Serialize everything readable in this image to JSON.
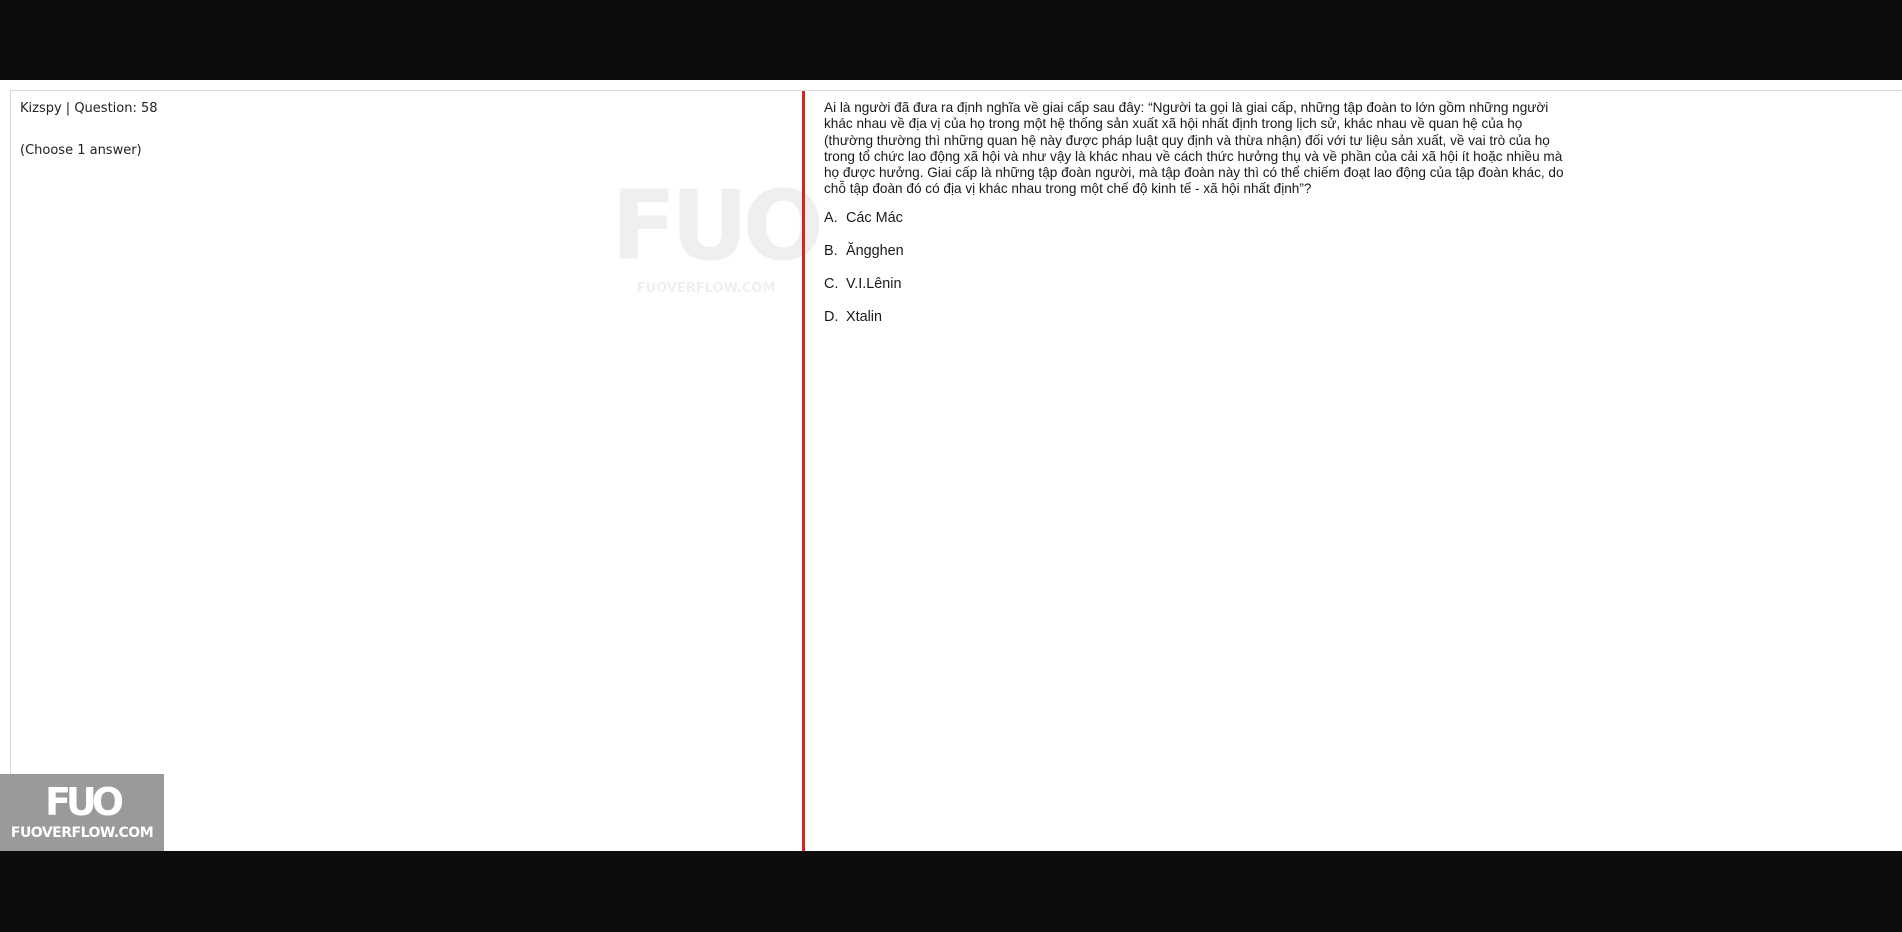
{
  "quiz": {
    "header": "Kizspy | Question: 58",
    "choose_hint": "(Choose 1 answer)",
    "question": "Ai là người đã đưa ra định nghĩa về giai cấp sau đây: “Người ta gọi là giai cấp, những tập đoàn to lớn gồm những người khác nhau về địa vị của họ trong một hệ thống sản xuất xã hội nhất định trong lịch sử, khác nhau về quan hệ của họ (thường thường thì những quan hệ này được pháp luật quy định và thừa nhận) đối với tư liệu sản xuất, về vai trò của họ trong tổ chức lao động xã hội và như vậy là khác nhau về cách thức hưởng thụ và về phần của cải xã hội ít hoặc nhiều mà họ được hưởng. Giai cấp là những tập đoàn người, mà tập đoàn này thì có thể chiếm đoạt lao động của tập đoàn khác, do chỗ tập đoàn đó có địa vị khác nhau trong một chế độ kinh tế - xã hội nhất định”?",
    "answers": [
      {
        "letter": "A.",
        "text": "Các Mác"
      },
      {
        "letter": "B.",
        "text": "Ăngghen"
      },
      {
        "letter": "C.",
        "text": "V.I.Lênin"
      },
      {
        "letter": "D.",
        "text": "Xtalin"
      }
    ]
  },
  "watermark": {
    "mark": "FUO",
    "site": "FUOVERFLOW.COM"
  },
  "logo": {
    "mark": "FUO",
    "site": "FUOVERFLOW.COM"
  },
  "colors": {
    "divider": "#e01f1f",
    "frame_bg": "#0d0d0d",
    "badge_bg": "#9a9a9a"
  }
}
